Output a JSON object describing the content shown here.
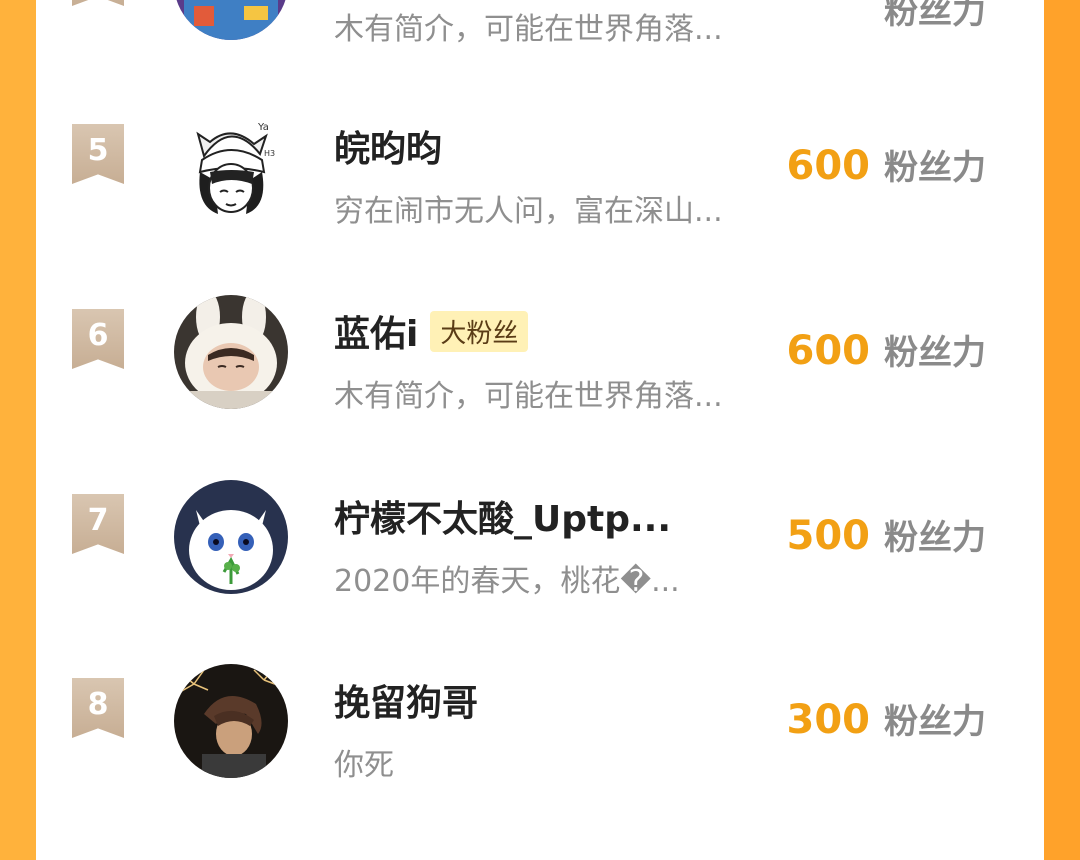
{
  "list": {
    "partial_top": {
      "desc": "木有简介，可能在世界角落...",
      "unit": "粉丝力"
    },
    "items": [
      {
        "rank": "5",
        "name": "皖昀昀",
        "badge": "",
        "desc": "穷在闹市无人问，富在深山...",
        "value": "600",
        "unit": "粉丝力",
        "avatar": "sketch-girl-cat-hat"
      },
      {
        "rank": "6",
        "name": "蓝佑i",
        "badge": "大粉丝",
        "desc": "木有简介，可能在世界角落...",
        "value": "600",
        "unit": "粉丝力",
        "avatar": "girl-bunny-hood"
      },
      {
        "rank": "7",
        "name": "柠檬不太酸_Uptp...",
        "badge": "",
        "desc": "2020年的春天，桃花�...",
        "value": "500",
        "unit": "粉丝力",
        "avatar": "white-cat-clover"
      },
      {
        "rank": "8",
        "name": "挽留狗哥",
        "badge": "",
        "desc": "你死",
        "value": "300",
        "unit": "粉丝力",
        "avatar": "anime-boy-fireworks"
      }
    ]
  },
  "colors": {
    "side_bg": "#ffa62e",
    "card_bg": "#ffffff",
    "score_color": "#f2a014",
    "rank_badge": "#cfb79e",
    "badge_bg": "#fff1b6"
  }
}
